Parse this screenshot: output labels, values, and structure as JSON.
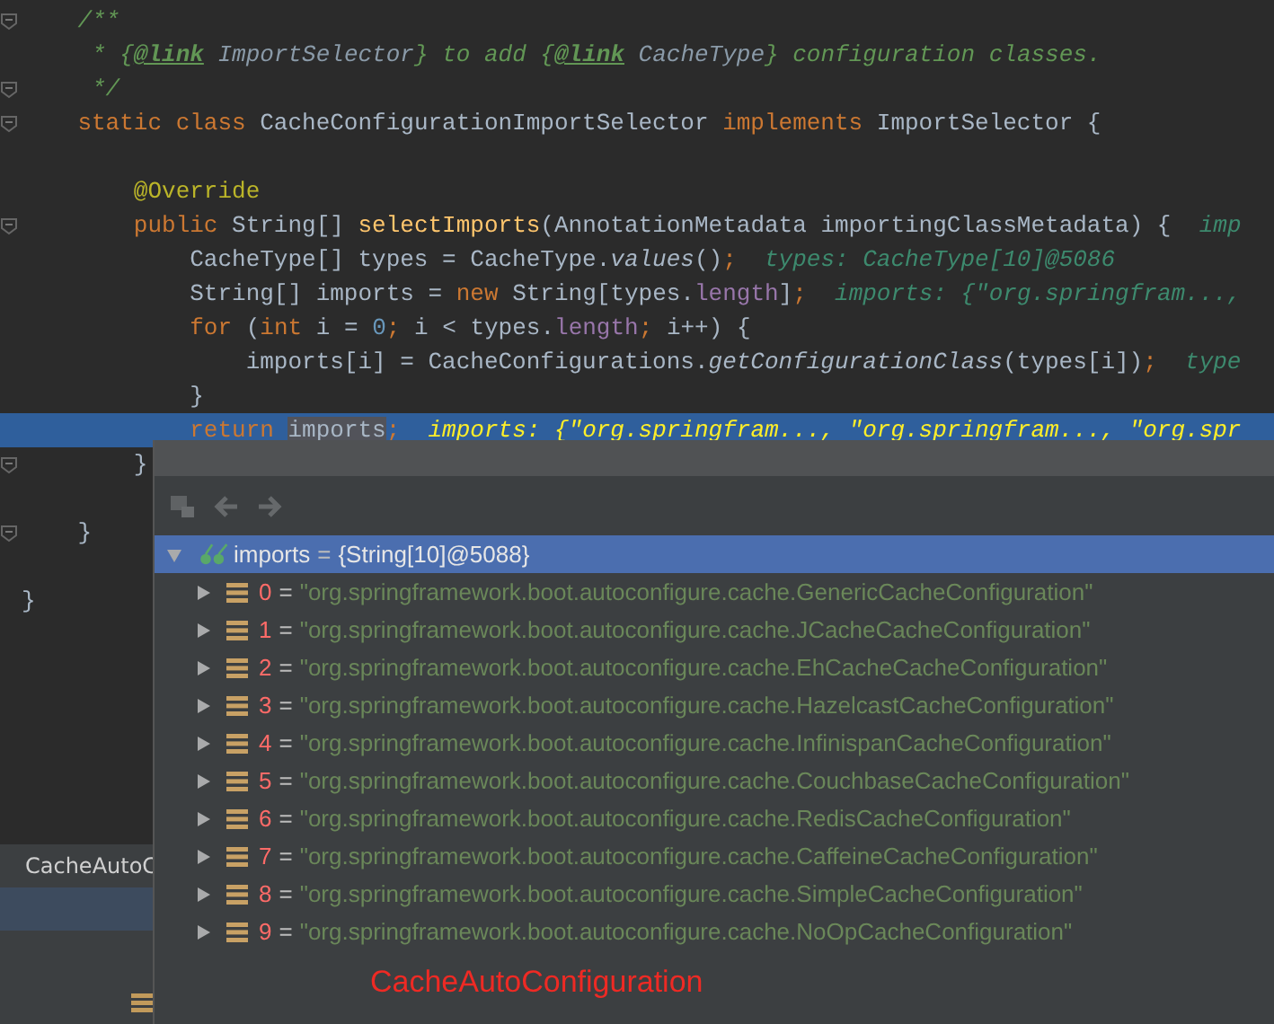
{
  "editor": {
    "lines": [
      {
        "fold": true,
        "highlighted": false,
        "tokens": [
          {
            "kind": "comment",
            "text": "    /**"
          }
        ]
      },
      {
        "fold": false,
        "highlighted": false,
        "tokens": [
          {
            "kind": "comment",
            "text": "     * {"
          },
          {
            "kind": "doc-tag",
            "text": "@link"
          },
          {
            "kind": "doc-ref",
            "text": " ImportSelector"
          },
          {
            "kind": "comment",
            "text": "} to add {"
          },
          {
            "kind": "doc-tag",
            "text": "@link"
          },
          {
            "kind": "doc-ref",
            "text": " CacheType"
          },
          {
            "kind": "comment",
            "text": "} configuration classes."
          }
        ]
      },
      {
        "fold": true,
        "highlighted": false,
        "tokens": [
          {
            "kind": "comment",
            "text": "     */"
          }
        ]
      },
      {
        "fold": true,
        "highlighted": false,
        "tokens": [
          {
            "kind": "keyword",
            "text": "    static class "
          },
          {
            "kind": "plain",
            "text": "CacheConfigurationImportSelector "
          },
          {
            "kind": "keyword",
            "text": "implements "
          },
          {
            "kind": "plain",
            "text": "ImportSelector {"
          }
        ]
      },
      {
        "fold": false,
        "highlighted": false
      },
      {
        "fold": false,
        "highlighted": false,
        "tokens": [
          {
            "kind": "annotation",
            "text": "        @Override"
          }
        ]
      },
      {
        "fold": true,
        "highlighted": false,
        "tokens": [
          {
            "kind": "keyword",
            "text": "        public "
          },
          {
            "kind": "plain",
            "text": "String[] "
          },
          {
            "kind": "method",
            "text": "selectImports"
          },
          {
            "kind": "plain",
            "text": "(AnnotationMetadata importingClassMetadata) {"
          },
          {
            "kind": "hint",
            "text": "  imp"
          }
        ]
      },
      {
        "fold": false,
        "highlighted": false,
        "tokens": [
          {
            "kind": "plain",
            "text": "            CacheType[] types = CacheType."
          },
          {
            "kind": "static-call",
            "text": "values"
          },
          {
            "kind": "plain",
            "text": "()"
          },
          {
            "kind": "keyword",
            "text": ";"
          },
          {
            "kind": "hint",
            "text": "  types: CacheType[10]@5086"
          }
        ]
      },
      {
        "fold": false,
        "highlighted": false,
        "tokens": [
          {
            "kind": "plain",
            "text": "            String[] imports = "
          },
          {
            "kind": "keyword",
            "text": "new "
          },
          {
            "kind": "plain",
            "text": "String[types."
          },
          {
            "kind": "field",
            "text": "length"
          },
          {
            "kind": "plain",
            "text": "]"
          },
          {
            "kind": "keyword",
            "text": ";"
          },
          {
            "kind": "hint",
            "text": "  imports: {\"org.springfram...,"
          }
        ]
      },
      {
        "fold": false,
        "highlighted": false,
        "tokens": [
          {
            "kind": "keyword",
            "text": "            for "
          },
          {
            "kind": "plain",
            "text": "("
          },
          {
            "kind": "keyword",
            "text": "int "
          },
          {
            "kind": "plain",
            "text": "i = "
          },
          {
            "kind": "number",
            "text": "0"
          },
          {
            "kind": "keyword",
            "text": ";"
          },
          {
            "kind": "plain",
            "text": " i < types."
          },
          {
            "kind": "field",
            "text": "length"
          },
          {
            "kind": "keyword",
            "text": ";"
          },
          {
            "kind": "plain",
            "text": " i++) {"
          }
        ]
      },
      {
        "fold": false,
        "highlighted": false,
        "tokens": [
          {
            "kind": "plain",
            "text": "                imports[i] = CacheConfigurations."
          },
          {
            "kind": "static-call",
            "text": "getConfigurationClass"
          },
          {
            "kind": "plain",
            "text": "(types[i])"
          },
          {
            "kind": "keyword",
            "text": ";"
          },
          {
            "kind": "hint",
            "text": "  type"
          }
        ]
      },
      {
        "fold": false,
        "highlighted": false,
        "tokens": [
          {
            "kind": "plain",
            "text": "            }"
          }
        ]
      },
      {
        "fold": false,
        "highlighted": true,
        "tokens": [
          {
            "kind": "keyword",
            "text": "            return "
          },
          {
            "kind": "caret-word",
            "text": "imports"
          },
          {
            "kind": "keyword",
            "text": ";"
          },
          {
            "kind": "hint",
            "text": "  imports: {\"org.springfram..., \"org.springfram..., \"org.spr"
          }
        ]
      },
      {
        "fold": true,
        "highlighted": false,
        "tokens": [
          {
            "kind": "plain",
            "text": "        }"
          }
        ]
      },
      {
        "fold": false,
        "highlighted": false
      },
      {
        "fold": true,
        "highlighted": false,
        "tokens": [
          {
            "kind": "plain",
            "text": "    }"
          }
        ]
      },
      {
        "fold": false,
        "highlighted": false
      },
      {
        "fold": false,
        "highlighted": false,
        "tokens": [
          {
            "kind": "plain",
            "text": "}"
          }
        ]
      }
    ]
  },
  "bottom_panel": {
    "tab": "CacheAutoC"
  },
  "popup": {
    "toolbar": [
      {
        "kind": "frames",
        "disabled": true
      },
      {
        "kind": "back",
        "disabled": true
      },
      {
        "kind": "forward",
        "disabled": true
      }
    ],
    "root": {
      "name": "imports",
      "op": "=",
      "value": "{String[10]@5088}",
      "expanded": true,
      "selected": true,
      "children": [
        {
          "index": "0",
          "op": "=",
          "value": "\"org.springframework.boot.autoconfigure.cache.GenericCacheConfiguration\"",
          "expanded": false,
          "selected": false
        },
        {
          "index": "1",
          "op": "=",
          "value": "\"org.springframework.boot.autoconfigure.cache.JCacheCacheConfiguration\"",
          "expanded": false,
          "selected": false
        },
        {
          "index": "2",
          "op": "=",
          "value": "\"org.springframework.boot.autoconfigure.cache.EhCacheCacheConfiguration\"",
          "expanded": false,
          "selected": false
        },
        {
          "index": "3",
          "op": "=",
          "value": "\"org.springframework.boot.autoconfigure.cache.HazelcastCacheConfiguration\"",
          "expanded": false,
          "selected": false
        },
        {
          "index": "4",
          "op": "=",
          "value": "\"org.springframework.boot.autoconfigure.cache.InfinispanCacheConfiguration\"",
          "expanded": false,
          "selected": false
        },
        {
          "index": "5",
          "op": "=",
          "value": "\"org.springframework.boot.autoconfigure.cache.CouchbaseCacheConfiguration\"",
          "expanded": false,
          "selected": false
        },
        {
          "index": "6",
          "op": "=",
          "value": "\"org.springframework.boot.autoconfigure.cache.RedisCacheConfiguration\"",
          "expanded": false,
          "selected": false
        },
        {
          "index": "7",
          "op": "=",
          "value": "\"org.springframework.boot.autoconfigure.cache.CaffeineCacheConfiguration\"",
          "expanded": false,
          "selected": false
        },
        {
          "index": "8",
          "op": "=",
          "value": "\"org.springframework.boot.autoconfigure.cache.SimpleCacheConfiguration\"",
          "expanded": false,
          "selected": false
        },
        {
          "index": "9",
          "op": "=",
          "value": "\"org.springframework.boot.autoconfigure.cache.NoOpCacheConfiguration\"",
          "expanded": false,
          "selected": false
        }
      ]
    },
    "annotation_label": "CacheAutoConfiguration"
  }
}
